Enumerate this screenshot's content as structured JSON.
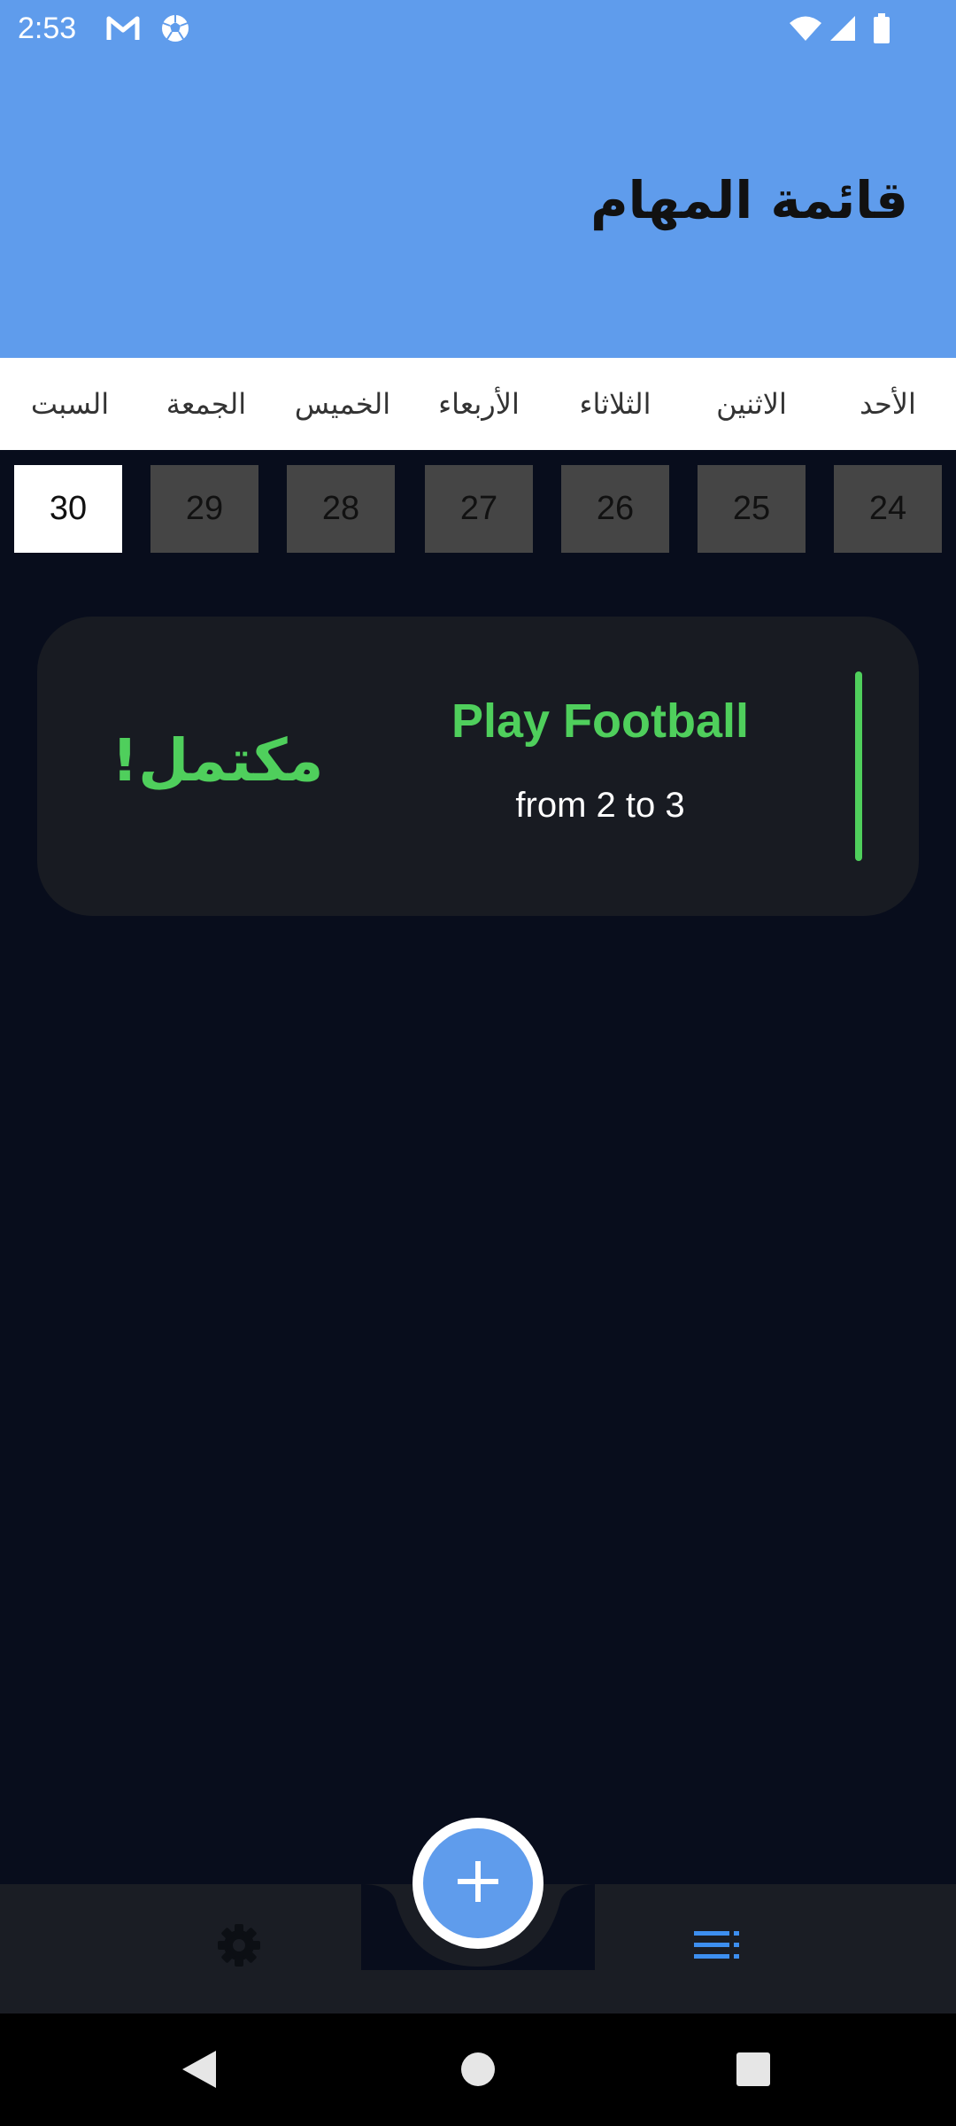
{
  "status_bar": {
    "time": "2:53",
    "left_icons": [
      "gmail-icon",
      "soccer-ball-icon"
    ],
    "right_icons": [
      "wifi-icon",
      "cellular-signal-icon",
      "battery-icon"
    ]
  },
  "header": {
    "title": "قائمة المهام",
    "color": "#5f9cec"
  },
  "week": {
    "days": [
      "الأحد",
      "الاثنين",
      "الثلاثاء",
      "الأربعاء",
      "الخميس",
      "الجمعة",
      "السبت"
    ],
    "dates": [
      "24",
      "25",
      "26",
      "27",
      "28",
      "29",
      "30"
    ],
    "selected_date": "30"
  },
  "tasks": [
    {
      "title": "Play Football",
      "time": "from 2 to 3",
      "status": "مكتمل!",
      "accent_color": "#4fcf5c"
    }
  ],
  "bottom_nav": {
    "items": [
      {
        "icon": "list-icon",
        "active": true
      },
      {
        "icon": "gear-icon",
        "active": false
      }
    ],
    "fab_icon": "plus-icon",
    "active_color": "#3d8ff0"
  },
  "system_nav": {
    "icons": [
      "back-icon",
      "home-icon",
      "recents-icon"
    ]
  }
}
